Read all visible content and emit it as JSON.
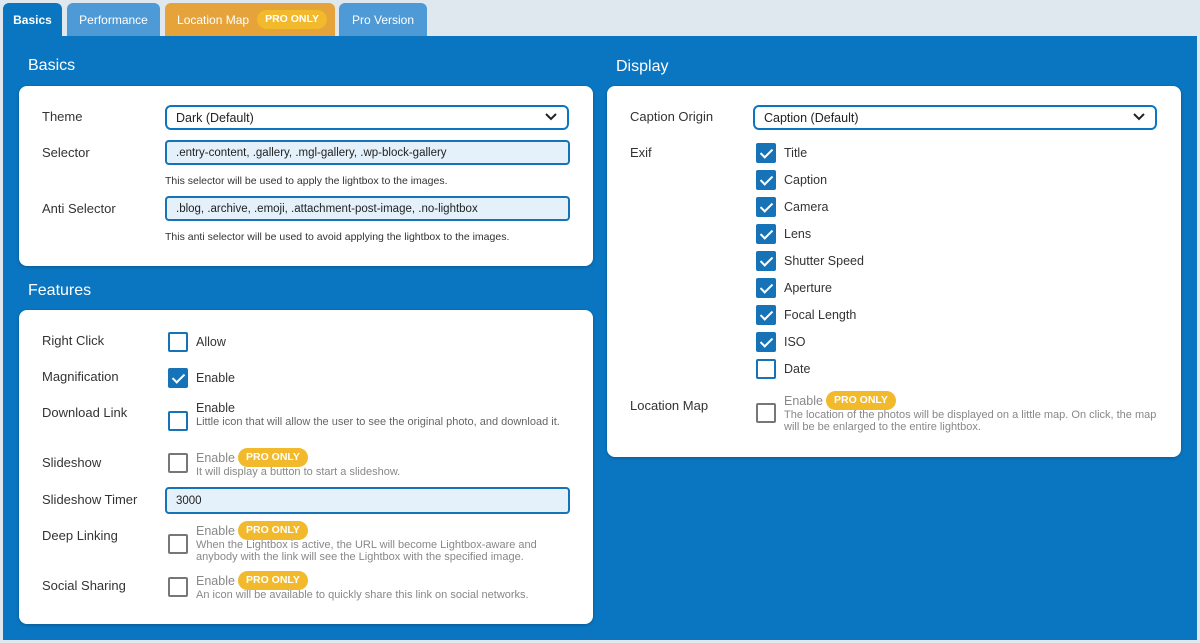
{
  "tabs": {
    "basics": "Basics",
    "performance": "Performance",
    "location_map": "Location Map",
    "location_map_badge": "PRO ONLY",
    "pro_version": "Pro Version"
  },
  "basics": {
    "title": "Basics",
    "theme_label": "Theme",
    "theme_value": "Dark (Default)",
    "selector_label": "Selector",
    "selector_value": ".entry-content, .gallery, .mgl-gallery, .wp-block-gallery",
    "selector_help": "This selector will be used to apply the lightbox to the images.",
    "anti_label": "Anti Selector",
    "anti_value": ".blog, .archive, .emoji, .attachment-post-image, .no-lightbox",
    "anti_help": "This anti selector will be used to avoid applying the lightbox to the images."
  },
  "features": {
    "title": "Features",
    "pro_badge": "PRO ONLY",
    "right_click_label": "Right Click",
    "right_click_text": "Allow",
    "magnification_label": "Magnification",
    "magnification_text": "Enable",
    "download_label": "Download Link",
    "download_text": "Enable",
    "download_desc": "Little icon that will allow the user to see the original photo, and download it.",
    "slideshow_label": "Slideshow",
    "slideshow_text": "Enable",
    "slideshow_desc": "It will display a button to start a slideshow.",
    "slideshow_timer_label": "Slideshow Timer",
    "slideshow_timer_value": "3000",
    "deep_linking_label": "Deep Linking",
    "deep_linking_text": "Enable",
    "deep_linking_desc": "When the Lightbox is active, the URL will become Lightbox-aware and anybody with the link will see the Lightbox with the specified image.",
    "social_label": "Social Sharing",
    "social_text": "Enable",
    "social_desc": "An icon will be available to quickly share this link on social networks."
  },
  "display": {
    "title": "Display",
    "caption_origin_label": "Caption Origin",
    "caption_origin_value": "Caption (Default)",
    "exif_label": "Exif",
    "exif_items": [
      {
        "label": "Title",
        "checked": true
      },
      {
        "label": "Caption",
        "checked": true
      },
      {
        "label": "Camera",
        "checked": true
      },
      {
        "label": "Lens",
        "checked": true
      },
      {
        "label": "Shutter Speed",
        "checked": true
      },
      {
        "label": "Aperture",
        "checked": true
      },
      {
        "label": "Focal Length",
        "checked": true
      },
      {
        "label": "ISO",
        "checked": true
      },
      {
        "label": "Date",
        "checked": false
      }
    ],
    "location_map_label": "Location Map",
    "location_map_text": "Enable",
    "location_map_badge": "PRO ONLY",
    "location_map_desc": "The location of the photos will be displayed on a little map. On click, the map will be be enlarged to the entire lightbox."
  },
  "colors": {
    "primary": "#0a76c1",
    "tab_inactive": "#4d9ad7",
    "tab_pro": "#e6a33a",
    "badge": "#f1b92b"
  }
}
